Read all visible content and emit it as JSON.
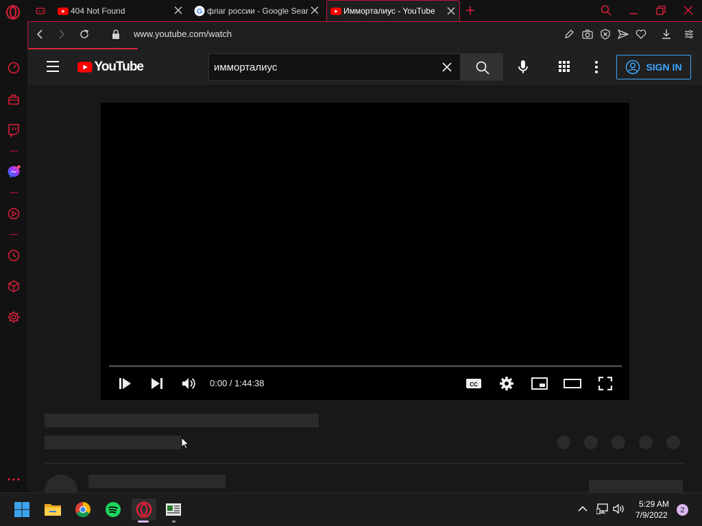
{
  "browser": {
    "tabs": [
      {
        "title": "404 Not Found",
        "icon": "youtube-icon",
        "active": false
      },
      {
        "title": "флаг россии - Google Sear",
        "icon": "google-icon",
        "active": false
      },
      {
        "title": "Имморталиус - YouTube",
        "icon": "youtube-icon",
        "active": true
      }
    ],
    "url": "www.youtube.com/watch",
    "accent": "#c7103d"
  },
  "youtube": {
    "logo_text": "YouTube",
    "search_value": "имморталиус",
    "sign_in_label": "SIGN IN",
    "player": {
      "timecode": "0:00 / 1:44:38",
      "cc_label": "CC"
    }
  },
  "taskbar": {
    "apps": [
      "windows-start",
      "file-explorer",
      "chrome",
      "spotify",
      "opera",
      "news-app"
    ],
    "time": "5:29 AM",
    "date": "7/9/2022",
    "notification_count": "2"
  }
}
